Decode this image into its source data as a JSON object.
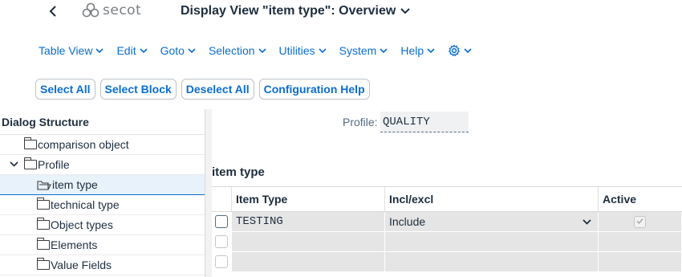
{
  "header": {
    "logo_text": "secot",
    "title": "Display View \"item type\": Overview"
  },
  "menu": [
    {
      "label": "Table View"
    },
    {
      "label": "Edit"
    },
    {
      "label": "Goto"
    },
    {
      "label": "Selection"
    },
    {
      "label": "Utilities"
    },
    {
      "label": "System"
    },
    {
      "label": "Help"
    }
  ],
  "toolbar": {
    "select_all": "Select All",
    "select_block": "Select Block",
    "deselect_all": "Deselect All",
    "configuration_help": "Configuration Help"
  },
  "dialog_structure": {
    "title": "Dialog Structure",
    "items": [
      {
        "label": "comparison object",
        "level": 0,
        "expanded": false
      },
      {
        "label": "Profile",
        "level": 0,
        "expanded": true
      },
      {
        "label": "item type",
        "level": 1,
        "selected": true
      },
      {
        "label": "technical type",
        "level": 1
      },
      {
        "label": "Object types",
        "level": 1
      },
      {
        "label": "Elements",
        "level": 1
      },
      {
        "label": "Value Fields",
        "level": 1
      }
    ]
  },
  "profile": {
    "label": "Profile:",
    "value": "QUALITY"
  },
  "table": {
    "title": "item type",
    "columns": [
      "Item Type",
      "Incl/excl",
      "Active"
    ],
    "rows": [
      {
        "item_type": "TESTING",
        "incl_excl": "Include",
        "active": true
      },
      {
        "item_type": "",
        "incl_excl": "",
        "active": false
      },
      {
        "item_type": "",
        "incl_excl": "",
        "active": false
      }
    ]
  },
  "colors": {
    "accent": "#0a6ed1",
    "text": "#1d2d3e",
    "cell_bg": "#e5e5e5"
  }
}
